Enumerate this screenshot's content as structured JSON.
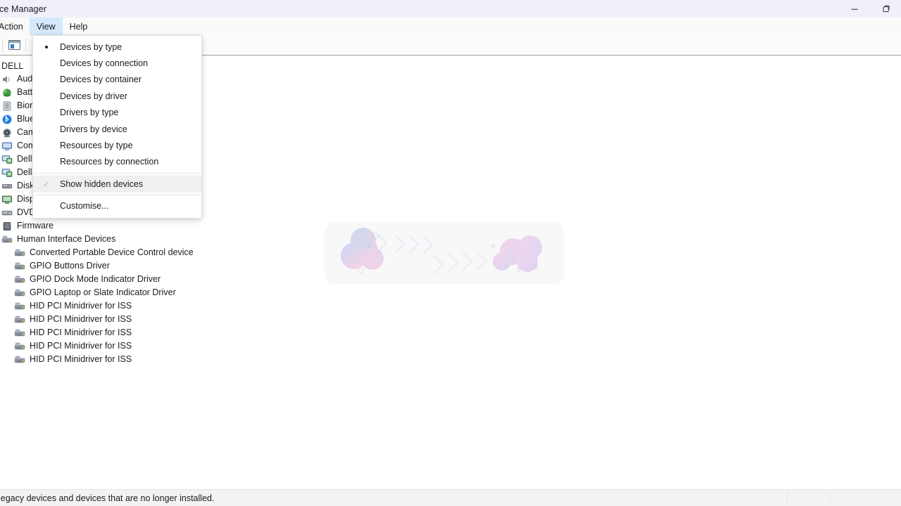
{
  "window": {
    "title": "ce Manager",
    "controls": [
      {
        "name": "minimize",
        "label": "Minimize"
      },
      {
        "name": "maximize",
        "label": "Maximize"
      }
    ]
  },
  "menubar": {
    "items": [
      {
        "label": "Action",
        "active": false
      },
      {
        "label": "View",
        "active": true
      },
      {
        "label": "Help",
        "active": false
      }
    ]
  },
  "toolbar": {
    "buttons": [
      {
        "name": "properties-window-icon",
        "label": "Properties"
      }
    ]
  },
  "view_menu": {
    "items": [
      {
        "label": "Devices by type",
        "marker": "bullet",
        "highlighted": false
      },
      {
        "label": "Devices by connection",
        "marker": "none",
        "highlighted": false
      },
      {
        "label": "Devices by container",
        "marker": "none",
        "highlighted": false
      },
      {
        "label": "Devices by driver",
        "marker": "none",
        "highlighted": false
      },
      {
        "label": "Drivers by type",
        "marker": "none",
        "highlighted": false
      },
      {
        "label": "Drivers by device",
        "marker": "none",
        "highlighted": false
      },
      {
        "label": "Resources by type",
        "marker": "none",
        "highlighted": false
      },
      {
        "label": "Resources by connection",
        "marker": "none",
        "highlighted": false
      },
      {
        "label": "Show hidden devices",
        "marker": "check",
        "highlighted": true
      },
      {
        "label": "Customise...",
        "marker": "none",
        "highlighted": false
      }
    ]
  },
  "tree": {
    "root": "DELL",
    "nodes": [
      {
        "label": "Aud",
        "icon": "speaker-icon",
        "level": 1
      },
      {
        "label": "Batt",
        "icon": "battery-icon",
        "level": 1
      },
      {
        "label": "Bior",
        "icon": "fingerprint-icon",
        "level": 1
      },
      {
        "label": "Blue",
        "icon": "bluetooth-icon",
        "level": 1
      },
      {
        "label": "Cam",
        "icon": "camera-icon",
        "level": 1
      },
      {
        "label": "Com",
        "icon": "monitor-icon",
        "level": 1
      },
      {
        "label": "Dell",
        "icon": "device-icon",
        "level": 1
      },
      {
        "label": "Dell",
        "icon": "device-icon",
        "level": 1
      },
      {
        "label": "Disk",
        "icon": "disk-icon",
        "level": 1
      },
      {
        "label": "Disp",
        "icon": "display-icon",
        "level": 1
      },
      {
        "label": "DVD,",
        "icon": "dvd-icon",
        "level": 1
      },
      {
        "label": "Firmware",
        "icon": "firmware-icon",
        "level": 1
      },
      {
        "label": "Human Interface Devices",
        "icon": "hid-icon",
        "level": 1
      },
      {
        "label": "Converted Portable Device Control device",
        "icon": "hid-icon",
        "level": 2
      },
      {
        "label": "GPIO Buttons Driver",
        "icon": "hid-icon",
        "level": 2
      },
      {
        "label": "GPIO Dock Mode Indicator Driver",
        "icon": "hid-icon",
        "level": 2
      },
      {
        "label": "GPIO Laptop or Slate Indicator Driver",
        "icon": "hid-icon",
        "level": 2
      },
      {
        "label": "HID PCI Minidriver for ISS",
        "icon": "hid-icon",
        "level": 2
      },
      {
        "label": "HID PCI Minidriver for ISS",
        "icon": "hid-icon",
        "level": 2
      },
      {
        "label": "HID PCI Minidriver for ISS",
        "icon": "hid-icon",
        "level": 2
      },
      {
        "label": "HID PCI Minidriver for ISS",
        "icon": "hid-icon",
        "level": 2
      },
      {
        "label": "HID PCI Minidriver for ISS",
        "icon": "hid-icon",
        "level": 2
      }
    ]
  },
  "statusbar": {
    "text": "legacy devices and devices that are no longer installed."
  },
  "colors": {
    "titlebar_bg": "#eff0fa",
    "menu_active_bg": "#d6e8fb",
    "menu_highlight_bg": "#f0f0f0",
    "statusbar_bg": "#f3f3f3",
    "content_bg": "#ffffff",
    "text": "#1b1b1f"
  }
}
